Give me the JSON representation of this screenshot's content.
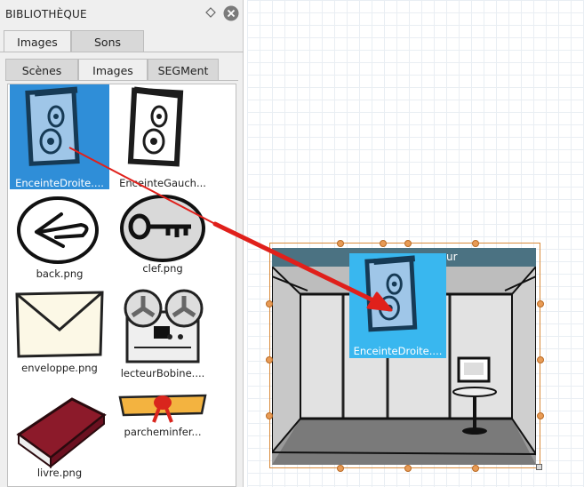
{
  "panel": {
    "title": "BIBLIOTHÈQUE",
    "main_tabs": [
      {
        "label": "Images",
        "selected": true
      },
      {
        "label": "Sons",
        "selected": false
      }
    ],
    "sub_tabs": [
      {
        "label": "Scènes",
        "selected": false
      },
      {
        "label": "Images",
        "selected": true
      },
      {
        "label": "SEGMent",
        "selected": false
      }
    ],
    "items": [
      {
        "label": "EnceinteDroite....",
        "icon": "speaker-right-icon",
        "selected": true
      },
      {
        "label": "EnceinteGauch...",
        "icon": "speaker-left-icon",
        "selected": false
      },
      {
        "label": "back.png",
        "icon": "back-arrow-icon",
        "selected": false
      },
      {
        "label": "clef.png",
        "icon": "key-icon",
        "selected": false
      },
      {
        "label": "enveloppe.png",
        "icon": "envelope-icon",
        "selected": false
      },
      {
        "label": "lecteurBobine....",
        "icon": "reel-player-icon",
        "selected": false
      },
      {
        "label": "livre.png",
        "icon": "book-icon",
        "selected": false
      },
      {
        "label": "parcheminfer...",
        "icon": "scroll-icon",
        "selected": false
      }
    ]
  },
  "canvas": {
    "scene_title_fragment": "ur",
    "drop_preview_label": "EnceinteDroite...."
  },
  "colors": {
    "selection": "#2f8ed8",
    "drop_highlight": "#39b7ef",
    "drag_arrow": "#e0201b",
    "handle": "#e89b55",
    "scene_header": "#4b7282"
  }
}
